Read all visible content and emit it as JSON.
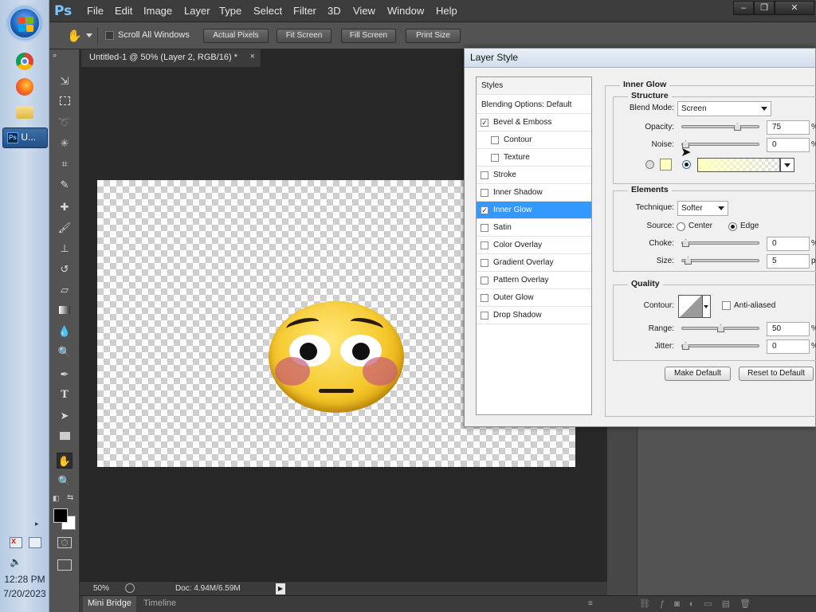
{
  "taskbar": {
    "ps_label": "U...",
    "time": "12:28 PM",
    "date": "7/20/2023"
  },
  "menubar": {
    "logo": "Ps",
    "items": [
      "File",
      "Edit",
      "Image",
      "Layer",
      "Type",
      "Select",
      "Filter",
      "3D",
      "View",
      "Window",
      "Help"
    ],
    "window_buttons": [
      "–",
      "❐",
      "✕"
    ]
  },
  "options": {
    "scroll_all": "Scroll All Windows",
    "actual_pixels": "Actual Pixels",
    "fit_screen": "Fit Screen",
    "fill_screen": "Fill Screen",
    "print_size": "Print Size"
  },
  "document": {
    "tab_title": "Untitled-1 @ 50% (Layer 2, RGB/16) *",
    "zoom": "50%",
    "doc_size": "Doc: 4.94M/6.59M"
  },
  "bottom_tabs": [
    "Mini Bridge",
    "Timeline"
  ],
  "layer_style": {
    "title": "Layer Style",
    "styles_header": "Styles",
    "blending_options": "Blending Options: Default",
    "styles": [
      {
        "label": "Bevel & Emboss",
        "checked": true
      },
      {
        "label": "Contour",
        "checked": false
      },
      {
        "label": "Texture",
        "checked": false
      },
      {
        "label": "Stroke",
        "checked": false
      },
      {
        "label": "Inner Shadow",
        "checked": false
      },
      {
        "label": "Inner Glow",
        "checked": true
      },
      {
        "label": "Satin",
        "checked": false
      },
      {
        "label": "Color Overlay",
        "checked": false
      },
      {
        "label": "Gradient Overlay",
        "checked": false
      },
      {
        "label": "Pattern Overlay",
        "checked": false
      },
      {
        "label": "Outer Glow",
        "checked": false
      },
      {
        "label": "Drop Shadow",
        "checked": false
      }
    ],
    "section_title": "Inner Glow",
    "structure": {
      "title": "Structure",
      "blend_mode_label": "Blend Mode:",
      "blend_mode": "Screen",
      "opacity_label": "Opacity:",
      "opacity": "75",
      "opacity_level": 0.75,
      "noise_label": "Noise:",
      "noise": "0",
      "noise_level": 0,
      "glow_color": "#ffffc0"
    },
    "elements": {
      "title": "Elements",
      "technique_label": "Technique:",
      "technique": "Softer",
      "source_label": "Source:",
      "center": "Center",
      "edge": "Edge",
      "choke_label": "Choke:",
      "choke": "0",
      "choke_level": 0,
      "size_label": "Size:",
      "size": "5",
      "size_level": 0.03,
      "size_unit": "px"
    },
    "quality": {
      "title": "Quality",
      "contour_label": "Contour:",
      "anti_aliased": "Anti-aliased",
      "range_label": "Range:",
      "range": "50",
      "range_level": 0.5,
      "jitter_label": "Jitter:",
      "jitter": "0",
      "jitter_level": 0
    },
    "percent": "%",
    "make_default": "Make Default",
    "reset_default": "Reset to Default"
  }
}
